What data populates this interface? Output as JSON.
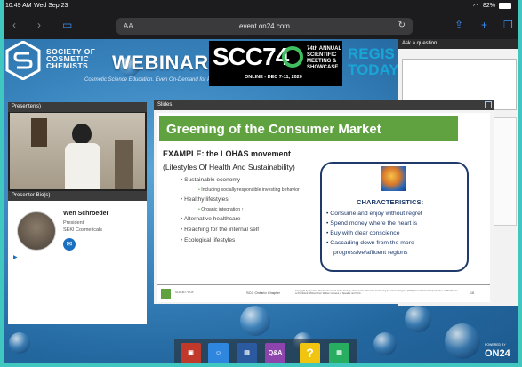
{
  "status_bar": {
    "time": "10:49 AM",
    "date": "Wed Sep 23",
    "battery": "82%"
  },
  "browser": {
    "text_size": "AA",
    "url": "event.on24.com"
  },
  "banner": {
    "society": [
      "SOCIETY OF",
      "COSMETIC",
      "CHEMISTS"
    ],
    "webinars": "WEBINARS",
    "tagline": "Cosmetic Science Education. Even On-Demand for Professionals",
    "scc_number": "SCC74",
    "scc_title": [
      "74th ANNUAL",
      "SCIENTIFIC",
      "MEETING &",
      "SHOWCASE"
    ],
    "scc_dates": "ONLINE - DEC 7-11, 2020",
    "register": [
      "REGIS",
      "TODAY"
    ]
  },
  "panels": {
    "ask_question": "Ask a question",
    "presenters": "Presenter(s)",
    "presenter_bio": "Presenter Bio(s)",
    "slides": "Slides"
  },
  "presenter": {
    "name": "Wen Schroeder",
    "title": "President",
    "company": "SEKI Cosmeticals"
  },
  "slide": {
    "title": "Greening of the Consumer Market",
    "example": "EXAMPLE:   the LOHAS movement",
    "lohas": "(Lifestyles Of Health And Sustainability)",
    "bullets": [
      {
        "text": "Sustainable economy",
        "level": 1
      },
      {
        "text": "Including socially responsible investing behavior",
        "level": 2
      },
      {
        "text": "Healthy lifestyles",
        "level": 1
      },
      {
        "text": "Organic integration ↑",
        "level": 2
      },
      {
        "text": "Alternative healthcare",
        "level": 1
      },
      {
        "text": "Reaching for the internal self",
        "level": 1
      },
      {
        "text": "Ecological lifestyles",
        "level": 1
      }
    ],
    "characteristics_title": "CHARACTERISTICS:",
    "characteristics": [
      "Consume and enjoy without regret",
      "Spend money where the heart is",
      "Buy with clear conscience",
      "Cascading down from the more",
      "progressive/affluent regions"
    ],
    "footer_chapter": "SCC Ontario Chapter",
    "footer_copyright": "Copyright by Speaker. Produced as Part of the Society of Cosmetic Chemists' Continuing Education Program (CEP). Unauthorized Reproduction or Distribution is Prohibited Without Prior Written Consent of Speaker and SCC.",
    "footer_page": "18"
  },
  "dock": {
    "qa_label": "Q&A",
    "help_label": "?"
  },
  "powered_by": {
    "small": "POWERED BY",
    "brand": "ON24"
  },
  "colors": {
    "frame": "#3fc7c0",
    "slide_green": "#5fa23f",
    "navy": "#1f3a6a"
  }
}
